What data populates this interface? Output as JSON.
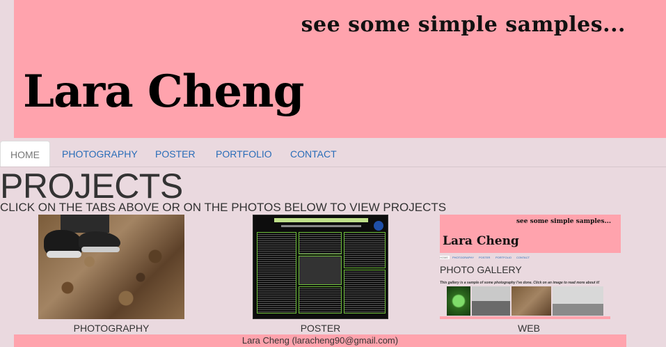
{
  "banner": {
    "tagline": "see some simple samples...",
    "name": "Lara Cheng"
  },
  "nav": {
    "tabs": [
      {
        "label": "HOME",
        "active": true
      },
      {
        "label": "PHOTOGRAPHY",
        "active": false
      },
      {
        "label": "POSTER",
        "active": false
      },
      {
        "label": "PORTFOLIO",
        "active": false
      },
      {
        "label": "CONTACT",
        "active": false
      }
    ]
  },
  "main": {
    "heading": "PROJECTS",
    "subheading": "CLICK ON THE TABS ABOVE OR ON THE PHOTOS BELOW TO VIEW PROJECTS",
    "projects": [
      {
        "caption": "PHOTOGRAPHY"
      },
      {
        "caption": "POSTER"
      },
      {
        "caption": "WEB"
      }
    ],
    "web_preview": {
      "tagline": "see some simple samples...",
      "name": "Lara Cheng",
      "nav": [
        "HOME",
        "PHOTOGRAPHY",
        "POSTER",
        "PORTFOLIO",
        "CONTACT"
      ],
      "gallery_title": "PHOTO GALLERY",
      "gallery_desc": "This gallery is a sample of some photography I've done. Click on an image to read more about it!"
    }
  },
  "footer": {
    "text": "Lara Cheng (laracheng90@gmail.com)"
  },
  "colors": {
    "banner": "#ffa3ad",
    "page": "#ead9df",
    "link": "#2a6db8"
  }
}
